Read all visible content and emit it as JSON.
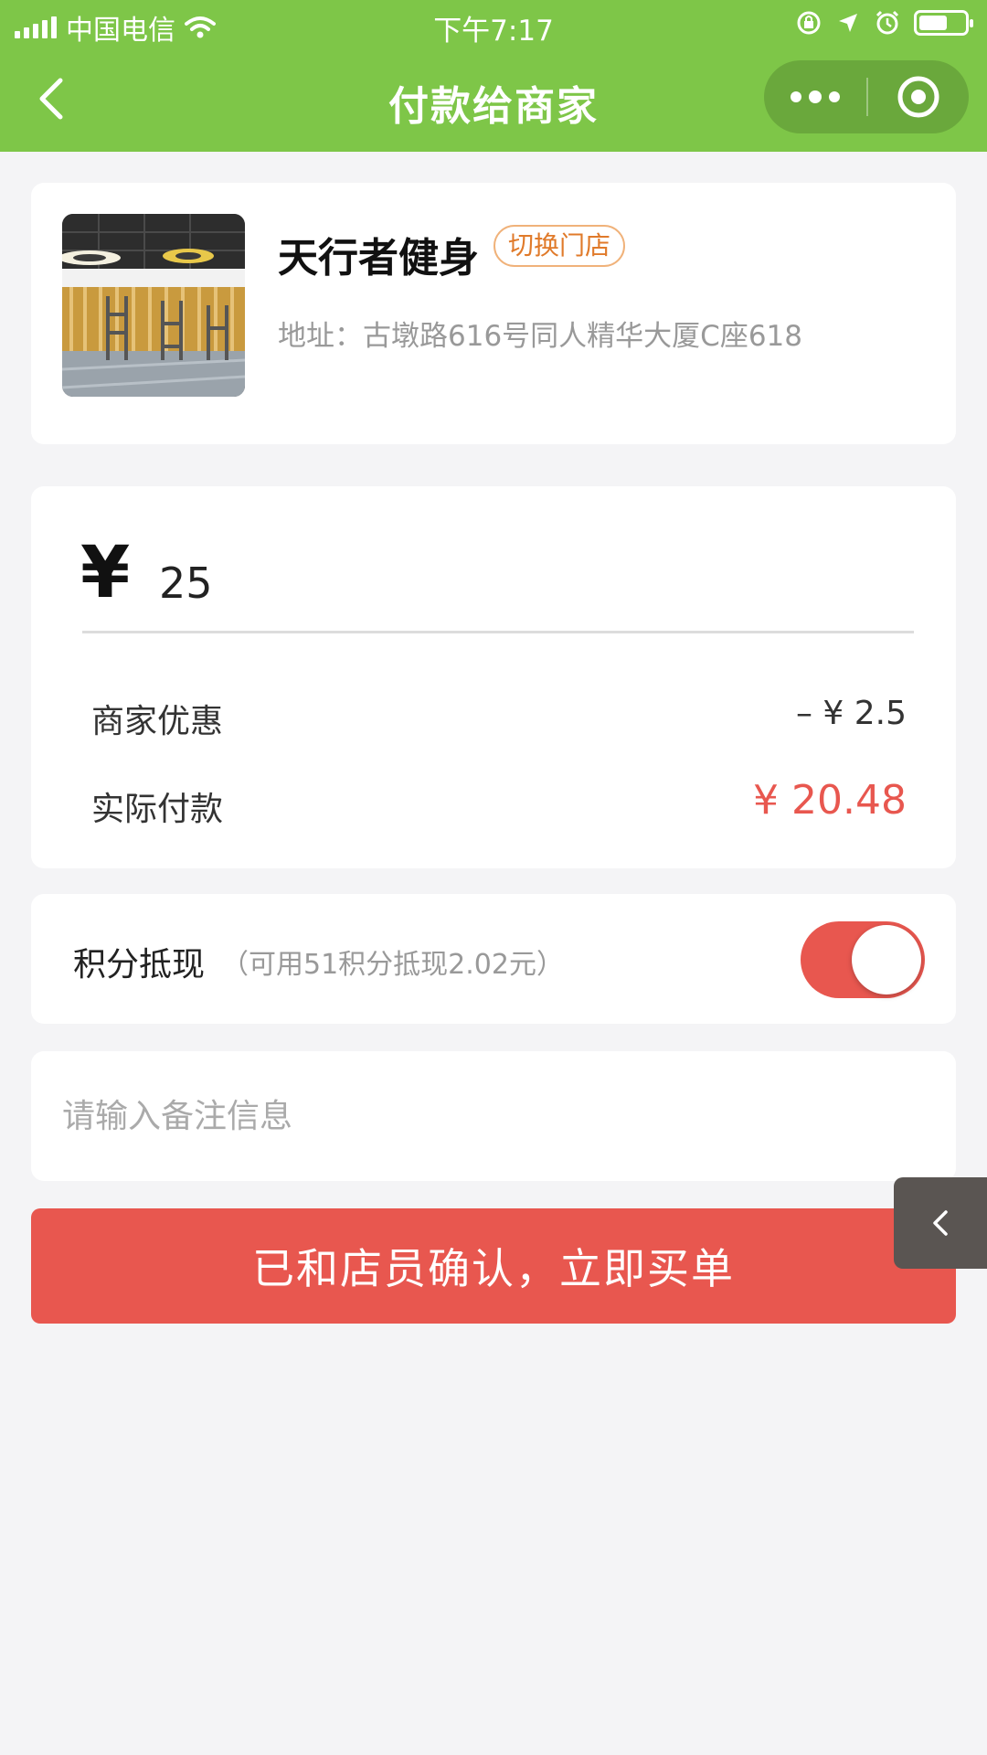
{
  "status_bar": {
    "carrier": "中国电信",
    "time": "下午7:17",
    "icons": [
      "signal-icon",
      "wifi-icon",
      "rotation-lock-icon",
      "location-icon",
      "alarm-icon",
      "battery-icon"
    ]
  },
  "nav": {
    "title": "付款给商家",
    "back_icon": "chevron-left-icon",
    "more_icon": "more-dots-icon",
    "close_icon": "target-circle-icon"
  },
  "store": {
    "name": "天行者健身",
    "switch_label": "切换门店",
    "address": "地址：古墩路616号同人精华大厦C座618"
  },
  "payment": {
    "currency_symbol": "¥",
    "amount": "25",
    "discount_label": "商家优惠",
    "discount_value": "– ¥ 2.5",
    "actual_label": "实际付款",
    "actual_value": "¥ 20.48"
  },
  "points": {
    "label": "积分抵现",
    "hint": "（可用51积分抵现2.02元）",
    "enabled": true
  },
  "note": {
    "placeholder": "请输入备注信息",
    "value": ""
  },
  "pay_button": {
    "label": "已和店员确认，立即买单"
  },
  "colors": {
    "brand_green": "#7ec648",
    "accent_red": "#e8574f",
    "tag_orange": "#e07a2a"
  }
}
